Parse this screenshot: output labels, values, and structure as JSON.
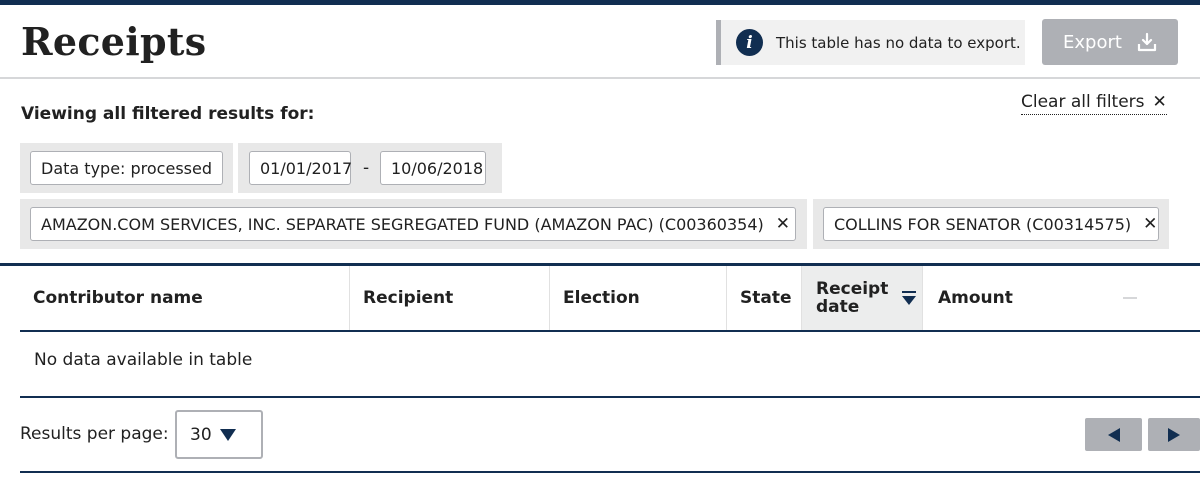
{
  "header": {
    "title": "Receipts",
    "notice_text": "This table has no data to export.",
    "export_label": "Export"
  },
  "filters": {
    "viewing_label": "Viewing all filtered results for:",
    "clear_all_label": "Clear all filters",
    "data_type_tag": "Data type: processed",
    "date_from": "01/01/2017",
    "date_separator": "-",
    "date_to": "10/06/2018",
    "committees": [
      {
        "label": "AMAZON.COM SERVICES, INC. SEPARATE SEGREGATED FUND (AMAZON PAC) (C00360354)"
      },
      {
        "label": "COLLINS FOR SENATOR (C00314575)"
      }
    ]
  },
  "table": {
    "columns": [
      {
        "label": "Contributor name"
      },
      {
        "label": "Recipient"
      },
      {
        "label": "Election"
      },
      {
        "label": "State"
      },
      {
        "label": "Receipt date",
        "sorted": "descending"
      },
      {
        "label": "Amount"
      }
    ],
    "empty_message": "No data available in table"
  },
  "pagination": {
    "results_per_page_label": "Results per page:",
    "results_per_page_value": "30"
  },
  "colors": {
    "navy": "#112e51",
    "gray_button": "#aeb0b5",
    "tag_background": "#e8e8e8"
  }
}
